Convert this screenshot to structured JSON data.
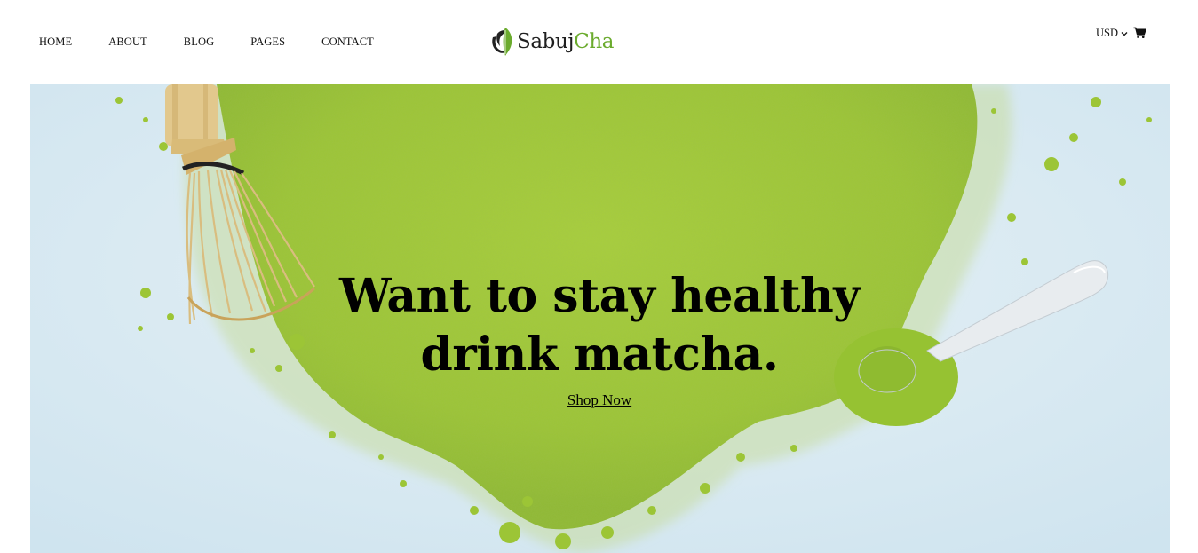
{
  "nav": {
    "items": [
      {
        "label": "HOME"
      },
      {
        "label": "ABOUT"
      },
      {
        "label": "BLOG"
      },
      {
        "label": "PAGES"
      },
      {
        "label": "CONTACT"
      }
    ]
  },
  "logo": {
    "text_primary": "Sabuj",
    "text_accent": "Cha",
    "primary_color": "#1f1f1f",
    "accent_color": "#6bab2e"
  },
  "header_right": {
    "currency": "USD",
    "chevron_icon": "chevron-down-icon",
    "cart_icon": "shopping-cart-icon"
  },
  "hero": {
    "title_line1": "Want to stay healthy",
    "title_line2": "drink matcha.",
    "cta_label": "Shop Now",
    "background_color": "#d3e8f1",
    "matcha_color": "#9cc83a",
    "image_description_icons": [
      "bamboo-whisk",
      "matcha-powder",
      "silver-spoon"
    ]
  }
}
